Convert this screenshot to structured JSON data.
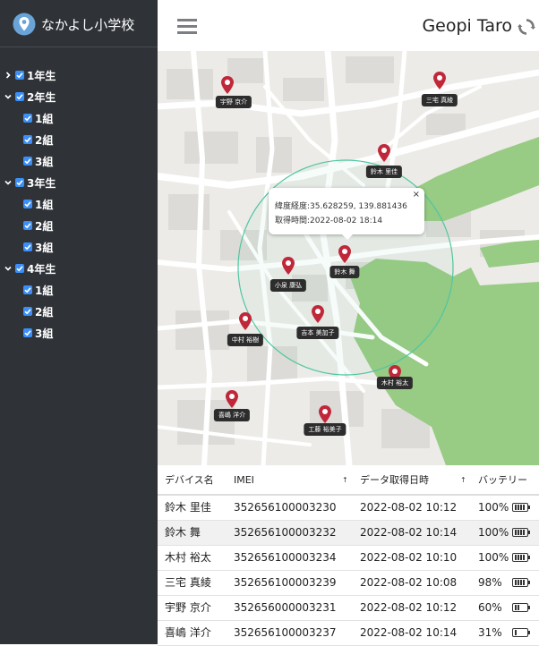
{
  "brand": {
    "name": "なかよし小学校"
  },
  "user": {
    "name": "Geopi Taro"
  },
  "sidebar": {
    "grades": [
      {
        "label": "1年生",
        "expanded": false,
        "checked": true,
        "classes": []
      },
      {
        "label": "2年生",
        "expanded": true,
        "checked": true,
        "classes": [
          "1組",
          "2組",
          "3組"
        ]
      },
      {
        "label": "3年生",
        "expanded": true,
        "checked": true,
        "classes": [
          "1組",
          "2組",
          "3組"
        ]
      },
      {
        "label": "4年生",
        "expanded": true,
        "checked": true,
        "classes": [
          "1組",
          "2組",
          "3組"
        ]
      }
    ]
  },
  "map": {
    "popup": {
      "coords": "緯度経度:35.628259, 139.881436",
      "time": "取得時間:2022-08-02 18:14",
      "close": "×"
    },
    "pins": [
      {
        "name": "宇野 京介"
      },
      {
        "name": "三宅 真綾"
      },
      {
        "name": "鈴木 里佳"
      },
      {
        "name": "鈴木 舞"
      },
      {
        "name": "小泉 康弘"
      },
      {
        "name": "吉本 美加子"
      },
      {
        "name": "中村 裕樹"
      },
      {
        "name": "木村 裕太"
      },
      {
        "name": "喜嶋 洋介"
      },
      {
        "name": "工藤 裕美子"
      }
    ]
  },
  "table": {
    "headers": {
      "device": "デバイス名",
      "imei": "IMEI",
      "time": "データ取得日時",
      "battery": "バッテリー"
    },
    "sort_arrow": "↑",
    "rows": [
      {
        "device": "鈴木 里佳",
        "imei": "352656100003230",
        "time": "2022-08-02 10:12",
        "battery": "100%",
        "level": 1.0
      },
      {
        "device": "鈴木 舞",
        "imei": "352656100003232",
        "time": "2022-08-02 10:14",
        "battery": "100%",
        "level": 1.0
      },
      {
        "device": "木村 裕太",
        "imei": "352656100003234",
        "time": "2022-08-02 10:10",
        "battery": "100%",
        "level": 1.0
      },
      {
        "device": "三宅 真綾",
        "imei": "352656100003239",
        "time": "2022-08-02 10:08",
        "battery": "98%",
        "level": 0.98
      },
      {
        "device": "宇野 京介",
        "imei": "352656000003231",
        "time": "2022-08-02 10:12",
        "battery": "60%",
        "level": 0.6
      },
      {
        "device": "喜嶋 洋介",
        "imei": "352656100003237",
        "time": "2022-08-02 10:14",
        "battery": "31%",
        "level": 0.31
      }
    ]
  },
  "colors": {
    "sidebar": "#2f3338",
    "pin": "#c0283a",
    "checkbox": "#3b8ff6",
    "park": "#98cb83",
    "geofence": "#4fc6a1"
  }
}
